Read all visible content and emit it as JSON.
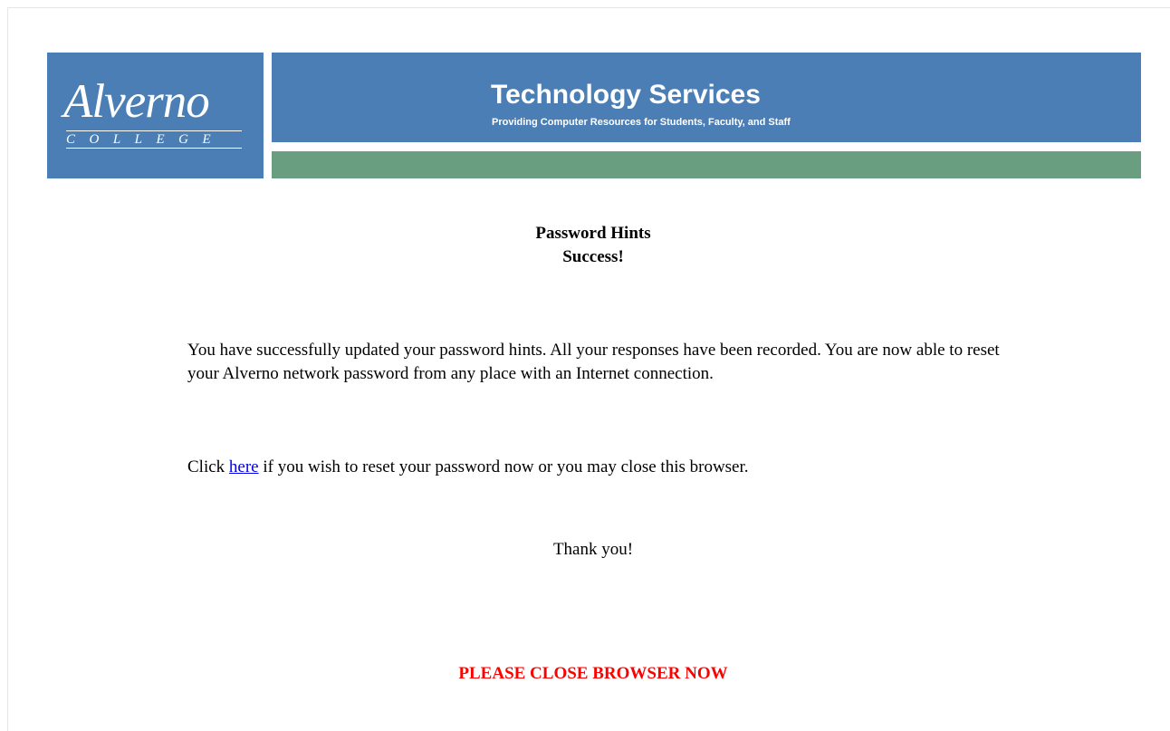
{
  "header": {
    "logo": {
      "name": "Alverno",
      "subtitle": "COLLEGE"
    },
    "title": "Technology Services",
    "tagline": "Providing Computer Resources for Students, Faculty, and Staff"
  },
  "content": {
    "heading": "Password Hints",
    "subheading": "Success!",
    "paragraph1": "You have successfully updated your password hints. All your responses have been recorded. You are now able to reset your Alverno network password from any place with an Internet connection.",
    "paragraph2_before": "Click ",
    "paragraph2_link": "here",
    "paragraph2_after": " if you wish to reset your password now or you may close this browser.",
    "thanks": "Thank you!",
    "warning": "PLEASE CLOSE BROWSER NOW"
  },
  "colors": {
    "header_blue": "#4a7eb5",
    "header_green": "#6a9e80",
    "link": "#0000ee",
    "warning": "#ff0000"
  }
}
